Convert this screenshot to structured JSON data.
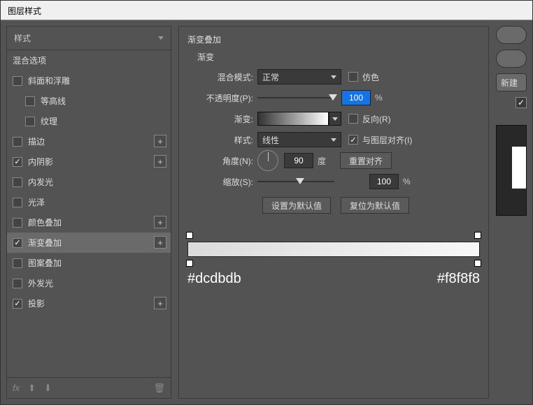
{
  "window": {
    "title": "图层样式"
  },
  "styles": {
    "header": "样式",
    "blend_options": "混合选项",
    "items": [
      {
        "label": "斜面和浮雕",
        "checked": false,
        "add": false
      },
      {
        "label": "等高线",
        "checked": false,
        "indent": true
      },
      {
        "label": "纹理",
        "checked": false,
        "indent": true
      },
      {
        "label": "描边",
        "checked": false,
        "add": true
      },
      {
        "label": "内阴影",
        "checked": true,
        "add": true
      },
      {
        "label": "内发光",
        "checked": false
      },
      {
        "label": "光泽",
        "checked": false
      },
      {
        "label": "颜色叠加",
        "checked": false,
        "add": true
      },
      {
        "label": "渐变叠加",
        "checked": true,
        "add": true,
        "selected": true
      },
      {
        "label": "图案叠加",
        "checked": false
      },
      {
        "label": "外发光",
        "checked": false
      },
      {
        "label": "投影",
        "checked": true,
        "add": true
      }
    ],
    "footer_fx": "fx"
  },
  "gradient": {
    "title": "渐变叠加",
    "section": "渐变",
    "blend_mode_label": "混合模式:",
    "blend_mode_value": "正常",
    "dither_label": "仿色",
    "dither_checked": false,
    "opacity_label": "不透明度(P):",
    "opacity_value": "100",
    "opacity_suffix": "%",
    "gradient_label": "渐变:",
    "reverse_label": "反向(R)",
    "reverse_checked": false,
    "style_label": "样式:",
    "style_value": "线性",
    "align_label": "与图层对齐(I)",
    "align_checked": true,
    "angle_label": "角度(N):",
    "angle_value": "90",
    "angle_suffix": "度",
    "reset_align": "重置对齐",
    "scale_label": "缩放(S):",
    "scale_value": "100",
    "scale_suffix": "%",
    "set_default": "设置为默认值",
    "reset_default": "复位为默认值",
    "hex_left": "#dcdbdb",
    "hex_right": "#f8f8f8"
  },
  "right": {
    "new_label": "新建"
  }
}
